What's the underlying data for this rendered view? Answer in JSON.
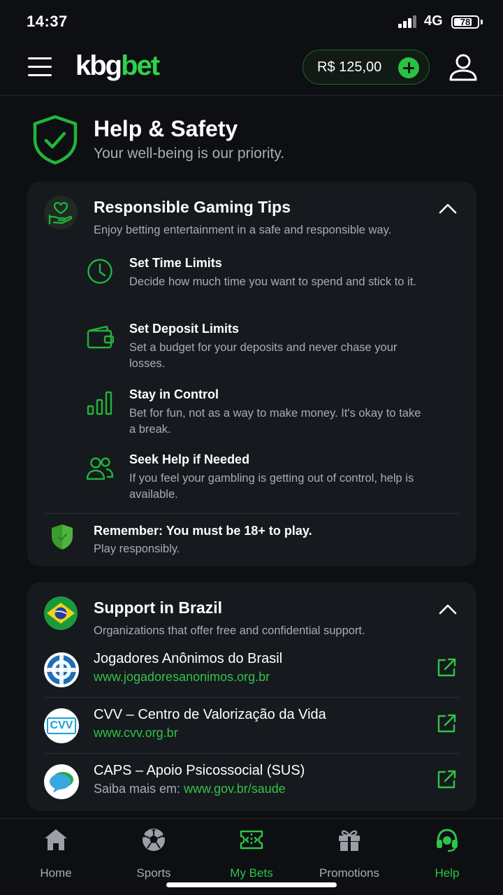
{
  "status": {
    "time": "14:37",
    "network": "4G",
    "battery": "78",
    "battery_level": 0.78
  },
  "header": {
    "logo_part1": "kbg",
    "logo_part2": "bet",
    "balance": "R$ 125,00"
  },
  "hero": {
    "title": "Help & Safety",
    "subtitle": "Your well-being is our priority.",
    "icon": "shield-check-icon"
  },
  "tips_card": {
    "title": "Responsible Gaming Tips",
    "description": "Enjoy betting entertainment in a safe and responsible way.",
    "items": [
      {
        "title": "Set Time Limits",
        "text": "Decide how much time you want to spend and stick to it.",
        "icon": "clock-icon"
      },
      {
        "title": "Set Deposit Limits",
        "text": "Set a budget for your deposits and never chase your losses.",
        "icon": "wallet-icon"
      },
      {
        "title": "Stay in Control",
        "text": "Bet for fun, not as a way to make money. It's okay to take a break.",
        "icon": "bar-chart-icon"
      },
      {
        "title": "Seek Help if Needed",
        "text": "If you feel your gambling is getting out of control, help is available.",
        "icon": "users-icon"
      }
    ],
    "remember_line1": "Remember: You must be 18+ to play.",
    "remember_line2": "Play responsibly."
  },
  "brazil_card": {
    "title": "Support in Brazil",
    "description": "Organizations that offer free and confidential support.",
    "orgs": [
      {
        "name": "Jogadores Anônimos do Brasil",
        "prefix": "",
        "link": "www.jogadoresanonimos.org.br"
      },
      {
        "name": "CVV – Centro de Valorização da Vida",
        "prefix": "",
        "link": "www.cvv.org.br",
        "logo_text": "CVV"
      },
      {
        "name": "CAPS – Apoio Psicossocial (SUS)",
        "prefix": "Saiba mais em: ",
        "link": "www.gov.br/saude"
      }
    ]
  },
  "nav": {
    "items": [
      {
        "label": "Home",
        "icon": "home-icon"
      },
      {
        "label": "Sports",
        "icon": "soccer-ball-icon"
      },
      {
        "label": "My Bets",
        "icon": "ticket-icon"
      },
      {
        "label": "Promotions",
        "icon": "gift-icon"
      },
      {
        "label": "Help",
        "icon": "headset-icon"
      }
    ],
    "active": "Help"
  },
  "colors": {
    "accent": "#2fc447",
    "background": "#0d0f12",
    "card": "#16191e",
    "muted_text": "#a9adb3"
  }
}
